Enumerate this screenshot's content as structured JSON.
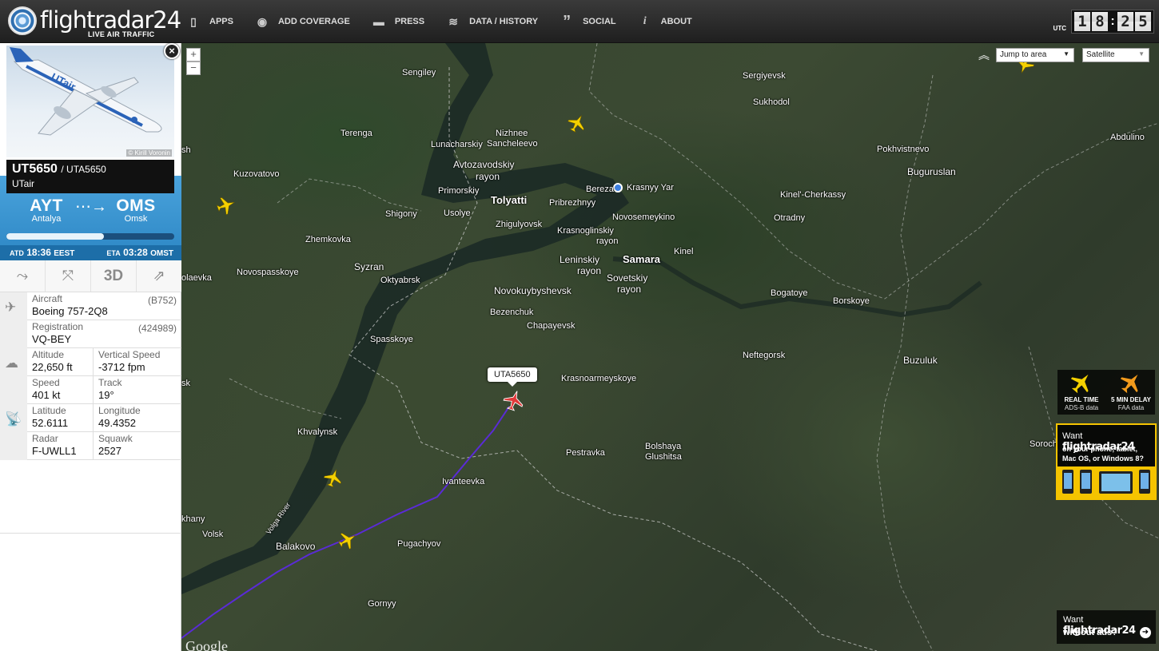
{
  "brand": {
    "name": "flightradar24",
    "tagline": "LIVE AIR TRAFFIC"
  },
  "nav": [
    {
      "label": "APPS",
      "icon": "phone-icon"
    },
    {
      "label": "ADD COVERAGE",
      "icon": "eye-icon"
    },
    {
      "label": "PRESS",
      "icon": "speech-bubble-icon"
    },
    {
      "label": "DATA / HISTORY",
      "icon": "database-icon"
    },
    {
      "label": "SOCIAL",
      "icon": "quote-icon"
    },
    {
      "label": "ABOUT",
      "icon": "info-icon"
    }
  ],
  "clock": {
    "zone": "UTC",
    "h1": "1",
    "h2": "8",
    "sep": ":",
    "m1": "2",
    "m2": "5"
  },
  "photo": {
    "credit": "© Kirill Voronin"
  },
  "flight": {
    "callsign": "UT5650",
    "icao_callsign": "/ UTA5650",
    "airline": "UTair",
    "origin": {
      "code": "AYT",
      "city": "Antalya"
    },
    "destination": {
      "code": "OMS",
      "city": "Omsk"
    },
    "progress_fraction": 0.58,
    "atd_label": "ATD",
    "atd_time": "18:36",
    "atd_tz": "EEST",
    "eta_label": "ETA",
    "eta_time": "03:28",
    "eta_tz": "OMST"
  },
  "tools": {
    "route": "route-icon",
    "fit": "fit-icon",
    "three_d": "3D",
    "share": "share-icon"
  },
  "details": {
    "aircraft_label": "Aircraft",
    "aircraft_value": "Boeing 757-2Q8",
    "aircraft_code": "(B752)",
    "registration_label": "Registration",
    "registration_value": "VQ-BEY",
    "registration_code": "(424989)",
    "altitude_label": "Altitude",
    "altitude_value": "22,650 ft",
    "vspeed_label": "Vertical Speed",
    "vspeed_value": "-3712 fpm",
    "speed_label": "Speed",
    "speed_value": "401 kt",
    "track_label": "Track",
    "track_value": "19°",
    "lat_label": "Latitude",
    "lat_value": "52.6111",
    "lon_label": "Longitude",
    "lon_value": "49.4352",
    "radar_label": "Radar",
    "radar_value": "F-UWLL1",
    "squawk_label": "Squawk",
    "squawk_value": "2527"
  },
  "map": {
    "zoom_in": "+",
    "zoom_out": "−",
    "jump_select": "Jump to area",
    "map_type": "Satellite",
    "selected_flight_label": "UTA5650",
    "river_label": "Volga River",
    "places": {
      "sengiley": "Sengiley",
      "sergiyevsk": "Sergiyevsk",
      "sukhodol": "Sukhodol",
      "terenga": "Terenga",
      "nizhnee": "Nizhnee",
      "sancheleevo": "Sancheleevo",
      "lunacharskiy": "Lunacharskiy",
      "pokhvistnevo": "Pokhvistnevo",
      "abdulino": "Abdulino",
      "sh": "sh",
      "kuzovatovo": "Kuzovatovo",
      "avtozavodskiy": "Avtozavodskiy",
      "avtozavodskiy_rayon": "rayon",
      "bugruslan": "Buguruslan",
      "bereza": "Bereza",
      "krasnyy_yar": "Krasnyy Yar",
      "primorskiy": "Primorskiy",
      "tolyatti": "Tolyatti",
      "kinel_cherkassy": "Kinel'-Cherkassy",
      "pribrezhnyy": "Pribrezhnyy",
      "shigony": "Shigony",
      "usolye": "Usolye",
      "novosemeykino": "Novosemeykino",
      "otradny": "Otradny",
      "zhigulyovsk": "Zhigulyovsk",
      "krasnoglinskiy": "Krasnoglinskiy",
      "krasnoglinskiy_rayon": "rayon",
      "zhemkovka": "Zhemkovka",
      "kinel": "Kinel",
      "syzran": "Syzran",
      "leninskiy": "Leninskiy",
      "samara": "Samara",
      "leninskiy_rayon": "rayon",
      "novospasskoye": "Novospasskoye",
      "oktyabrsk": "Oktyabrsk",
      "sovetskiy": "Sovetskiy",
      "sovetskiy_rayon": "rayon",
      "olaevka": "olaevka",
      "novokuybyshevsk": "Novokuybyshevsk",
      "bogatoye": "Bogatoye",
      "borskoye": "Borskoye",
      "bezenchuk": "Bezenchuk",
      "chapayevsk": "Chapayevsk",
      "spasskoye": "Spasskoye",
      "neftegorsk": "Neftegorsk",
      "buzuluk": "Buzuluk",
      "krasnoarmeyskoye": "Krasnoarmeyskoye",
      "sk": "sk",
      "khvalynsk": "Khvalynsk",
      "bolshaya": "Bolshaya",
      "glushitsa": "Glushitsa",
      "pestravka": "Pestravka",
      "sorochinsk": "Soroch",
      "ivanteevka": "Ivanteevka",
      "khany": "khany",
      "volsk": "Volsk",
      "balakovo": "Balakovo",
      "pugachyov": "Pugachyov",
      "gornyy": "Gornyy"
    },
    "google": "Google"
  },
  "ads": {
    "realtime_title": "REAL TIME",
    "realtime_sub": "ADS-B data",
    "delay_title": "5 MIN DELAY",
    "delay_sub": "FAA data",
    "phone_want": "Want",
    "phone_brand": "flightradar24",
    "phone_line1": "on your phone, tablet,",
    "phone_line2": "Mac OS, or Windows 8?",
    "noads_want": "Want",
    "noads_brand": "flightradar24",
    "noads_line": "without ads?"
  },
  "colors": {
    "route_line": "#5a2bd6",
    "selected_plane": "#e03a3a",
    "other_planes": "#f4d000",
    "header_blue": "#2c86c4"
  }
}
